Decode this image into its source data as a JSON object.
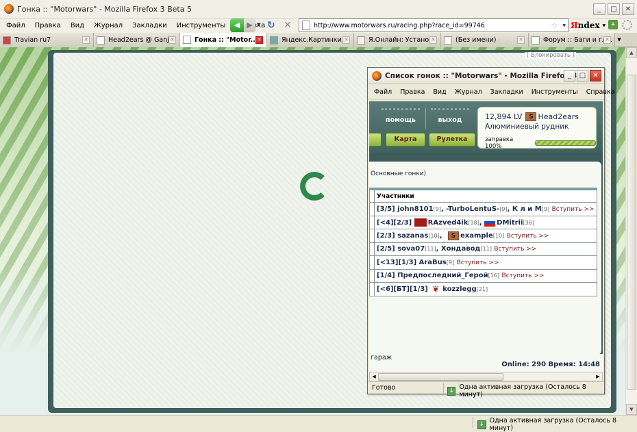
{
  "window": {
    "title": "Гонка :: \"Motorwars\" - Mozilla Firefox 3 Beta 5"
  },
  "menu": [
    "Файл",
    "Правка",
    "Вид",
    "Журнал",
    "Закладки",
    "Инструменты",
    "Справка"
  ],
  "url": "http://www.motorwars.ru/racing.php?race_id=99746",
  "search_engine": {
    "y": "Я",
    "rest": "ndex"
  },
  "tabs": [
    {
      "label": "Travian ru7",
      "active": false
    },
    {
      "label": "Head2ears @ Ganj...",
      "active": false
    },
    {
      "label": "Гонка :: \"Motor...",
      "active": true
    },
    {
      "label": "Яндекс.Картинки...",
      "active": false
    },
    {
      "label": "Я.Онлайн: Устано...",
      "active": false
    },
    {
      "label": "(Без имени)",
      "active": false
    },
    {
      "label": "Форум :: Баги и гл...",
      "active": false
    }
  ],
  "page": {
    "block_label": "[ Блокировать ]"
  },
  "status": {
    "download": "Одна активная загрузка (Осталось 8 минут)"
  },
  "popup": {
    "title": "Список гонок :: \"Motorwars\" - Mozilla Firefox 3 ...",
    "menu": [
      "Файл",
      "Правка",
      "Вид",
      "Журнал",
      "Закладки",
      "Инструменты",
      "Справка"
    ],
    "nav": {
      "help": "помощь",
      "exit": "выход",
      "map": "Карта",
      "roulette": "Рулетка"
    },
    "player": {
      "lv": "12,894 LV",
      "avatar_letter": "S",
      "name": "Head2ears",
      "location": "Алюминиевый рудник",
      "fuel_label": "заправка 100%",
      "fuel_level": 1.0
    },
    "breadcrumb": "Основные гонки)",
    "table_header": "Участники",
    "join": "Вступить >>",
    "rows": [
      {
        "prefix": "[3/5]",
        "p1": "john8101",
        "p1lv": "[9]",
        "sep1": ", ",
        "p2": "-TurboLentuS-",
        "p2lv": "[9]",
        "sep2": ", ",
        "p3": "К л и М",
        "p3lv": "[9]",
        "join": true
      },
      {
        "prefix": "[<4][2/3]",
        "p1": "RAzved4ik",
        "p1lv": "[18]",
        "sep1": ", ",
        "p2": "DMitrii",
        "p2lv": "[36]",
        "join": false
      },
      {
        "prefix": "[2/3]",
        "p1": "sazanas",
        "p1lv": "[10]",
        "sep1": ", ",
        "p2": "example",
        "p2lv": "[10]",
        "join": true
      },
      {
        "prefix": "[2/5]",
        "p1": "sova07",
        "p1lv": "[11]",
        "sep1": ", ",
        "p2": "Хондавод",
        "p2lv": "[11]",
        "join": true
      },
      {
        "prefix": "[<13][1/3]",
        "p1": "AraBus",
        "p1lv": "[9]",
        "join": true
      },
      {
        "prefix": "[1/4]",
        "p1": "Предпоследний_Герой",
        "p1lv": "[16]",
        "join": true
      },
      {
        "prefix": "[<6][БТ][1/3]",
        "p1": "kozzlegg",
        "p1lv": "[21]",
        "join": false
      }
    ],
    "garage": "гараж",
    "online": "Online: 290  Время: 14:48",
    "status": "Готово",
    "download": "Одна активная загрузка (Осталось 8 минут)"
  }
}
